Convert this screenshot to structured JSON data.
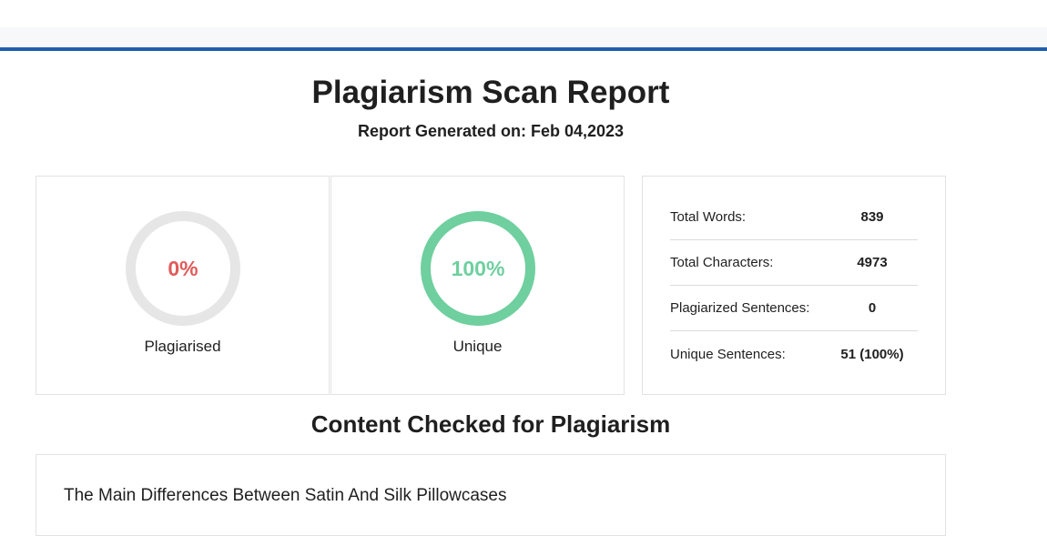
{
  "header": {
    "title": "Plagiarism Scan Report",
    "subtitle": "Report Generated on: Feb 04,2023"
  },
  "colors": {
    "accent_line": "#1f5fad",
    "plagiarised": "#e15a5a",
    "unique": "#6fcf9f",
    "ring_empty": "#e6e6e6"
  },
  "results": {
    "plagiarised": {
      "percent": "0%",
      "label": "Plagiarised"
    },
    "unique": {
      "percent": "100%",
      "label": "Unique"
    }
  },
  "stats": [
    {
      "label": "Total Words:",
      "value": "839"
    },
    {
      "label": "Total Characters:",
      "value": "4973"
    },
    {
      "label": "Plagiarized Sentences:",
      "value": "0"
    },
    {
      "label": "Unique Sentences:",
      "value": "51 (100%)"
    }
  ],
  "content": {
    "section_title": "Content Checked for Plagiarism",
    "first_line": "The Main Differences Between Satin And Silk Pillowcases"
  }
}
